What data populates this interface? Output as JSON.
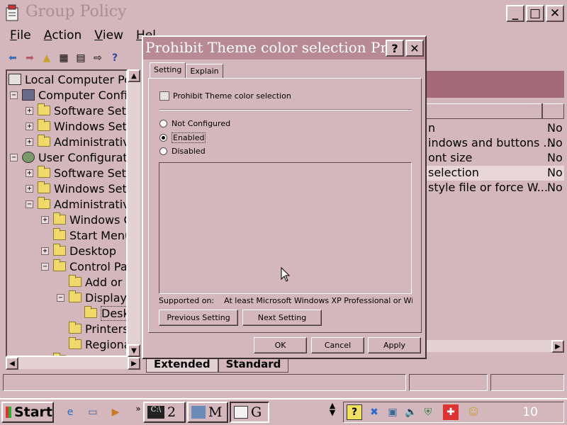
{
  "main_window": {
    "title": "Group Policy",
    "menu": [
      {
        "label": "File",
        "key": "F",
        "rest": "ile"
      },
      {
        "label": "Action",
        "key": "A",
        "rest": "ction"
      },
      {
        "label": "View",
        "key": "V",
        "rest": "iew"
      },
      {
        "label": "Help",
        "key": "H",
        "rest": "el"
      }
    ],
    "tree": [
      {
        "label": "Local Computer Pol",
        "icon": "policy-icon"
      },
      {
        "label": "Computer Config",
        "icon": "computer-icon",
        "expander": "−"
      },
      {
        "label": "Software Setti",
        "icon": "folder-icon",
        "expander": "+"
      },
      {
        "label": "Windows Setti",
        "icon": "folder-icon",
        "expander": "+"
      },
      {
        "label": "Administrative",
        "icon": "folder-icon",
        "expander": "+"
      },
      {
        "label": "User Configuration",
        "icon": "user-icon",
        "expander": "−"
      },
      {
        "label": "Software Setti",
        "icon": "folder-icon",
        "expander": "+"
      },
      {
        "label": "Windows Setti",
        "icon": "folder-icon",
        "expander": "+"
      },
      {
        "label": "Administrative",
        "icon": "folder-icon",
        "expander": "−"
      },
      {
        "label": "Windows C",
        "icon": "folder-icon",
        "expander": "+"
      },
      {
        "label": "Start Menu",
        "icon": "folder-icon",
        "expander": ""
      },
      {
        "label": "Desktop",
        "icon": "folder-icon",
        "expander": "+"
      },
      {
        "label": "Control Par",
        "icon": "folder-icon",
        "expander": "−"
      },
      {
        "label": "Add or F",
        "icon": "folder-icon",
        "expander": ""
      },
      {
        "label": "Display",
        "icon": "folder-icon",
        "expander": "−"
      },
      {
        "label": "Desk",
        "icon": "folder-icon",
        "expander": ""
      },
      {
        "label": "Printers",
        "icon": "folder-icon",
        "expander": ""
      },
      {
        "label": "Regiona",
        "icon": "folder-icon",
        "expander": ""
      },
      {
        "label": "Shared Fol",
        "icon": "folder-icon",
        "expander": "+"
      }
    ],
    "list_rows": [
      {
        "name": "n",
        "state": "No"
      },
      {
        "name": "indows and buttons ...",
        "state": "No"
      },
      {
        "name": "ont size",
        "state": "No"
      },
      {
        "name": "selection",
        "state": "No"
      },
      {
        "name": "style file or force W...",
        "state": "No"
      }
    ],
    "bottom_tabs": [
      "Extended",
      "Standard"
    ]
  },
  "dialog": {
    "title": "Prohibit Theme color selection Pr...",
    "help_label": "?",
    "close_label": "✕",
    "tabs": [
      "Setting",
      "Explain"
    ],
    "policy_name": "Prohibit Theme color selection",
    "radios": [
      {
        "label": "Not Configured",
        "checked": false
      },
      {
        "label": "Enabled",
        "checked": true
      },
      {
        "label": "Disabled",
        "checked": false
      }
    ],
    "supported_label": "Supported on:",
    "supported_value": "At least Microsoft Windows XP Professional or Windo...",
    "previous_label": "Previous Setting",
    "next_label": "Next Setting",
    "ok_label": "OK",
    "cancel_label": "Cancel",
    "apply_label": "Apply"
  },
  "taskbar": {
    "start_label": "Start",
    "task_m": "M",
    "task_g": "G",
    "task_cmd": "2",
    "clock": "10"
  }
}
